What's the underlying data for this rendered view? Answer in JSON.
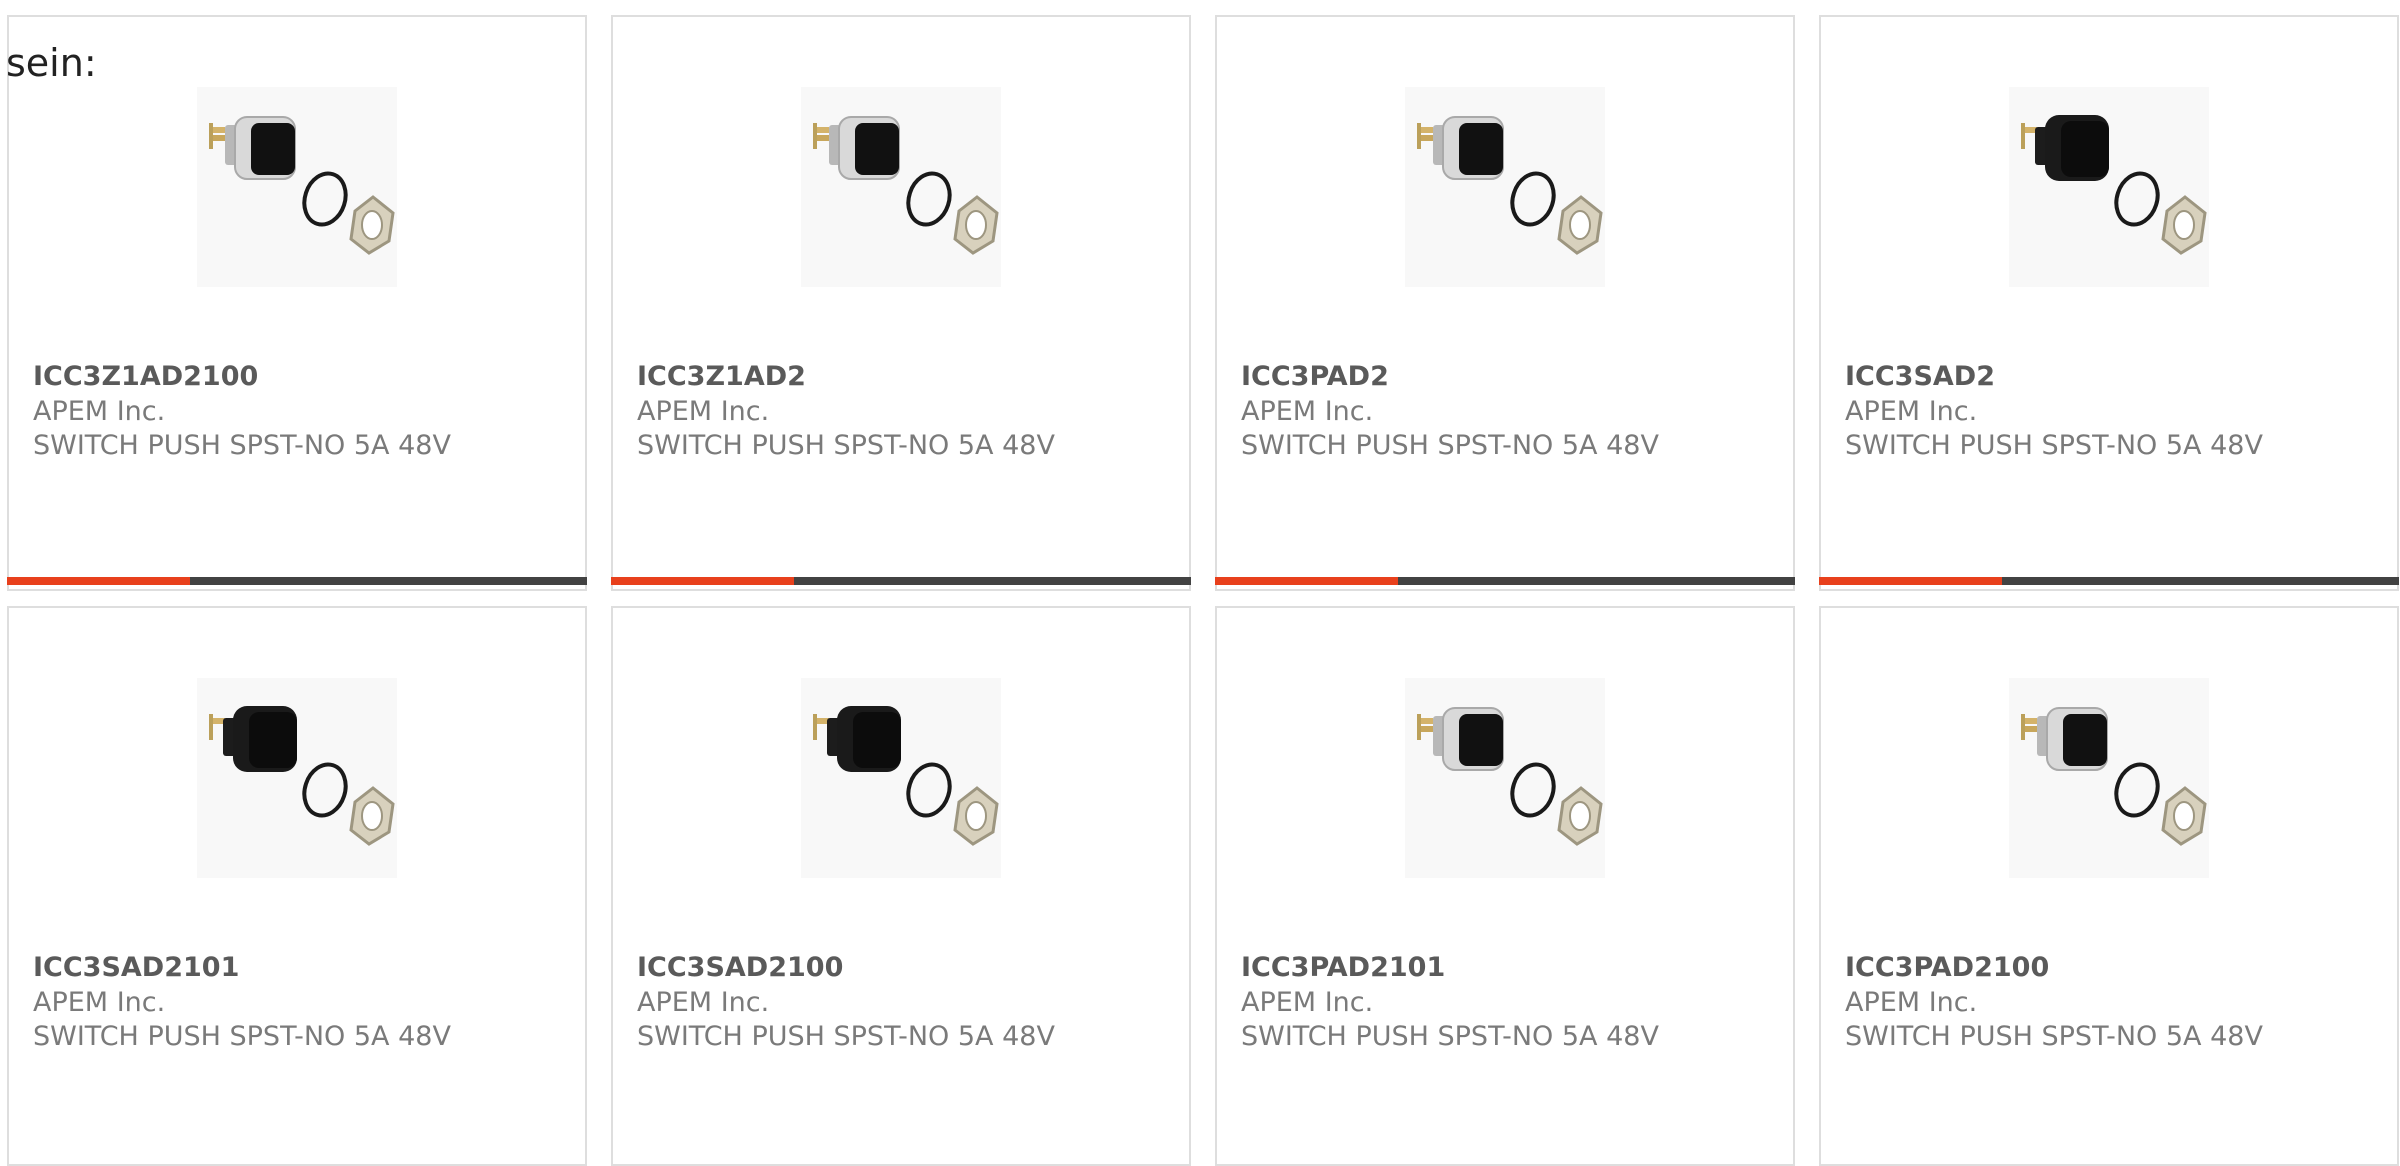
{
  "intro": "sein:",
  "colors": {
    "accent": "#e8401c",
    "bar": "#424242",
    "border": "#dedede"
  },
  "products": [
    {
      "part_number": "ICC3Z1AD2100",
      "manufacturer": "APEM Inc.",
      "description": "SWITCH PUSH SPST-NO 5A 48V",
      "image": "silver-bezel-switch"
    },
    {
      "part_number": "ICC3Z1AD2",
      "manufacturer": "APEM Inc.",
      "description": "SWITCH PUSH SPST-NO 5A 48V",
      "image": "silver-bezel-switch"
    },
    {
      "part_number": "ICC3PAD2",
      "manufacturer": "APEM Inc.",
      "description": "SWITCH PUSH SPST-NO 5A 48V",
      "image": "silver-bezel-switch"
    },
    {
      "part_number": "ICC3SAD2",
      "manufacturer": "APEM Inc.",
      "description": "SWITCH PUSH SPST-NO 5A 48V",
      "image": "black-bezel-switch"
    },
    {
      "part_number": "ICC3SAD2101",
      "manufacturer": "APEM Inc.",
      "description": "SWITCH PUSH SPST-NO 5A 48V",
      "image": "black-bezel-switch"
    },
    {
      "part_number": "ICC3SAD2100",
      "manufacturer": "APEM Inc.",
      "description": "SWITCH PUSH SPST-NO 5A 48V",
      "image": "black-bezel-switch"
    },
    {
      "part_number": "ICC3PAD2101",
      "manufacturer": "APEM Inc.",
      "description": "SWITCH PUSH SPST-NO 5A 48V",
      "image": "silver-bezel-switch"
    },
    {
      "part_number": "ICC3PAD2100",
      "manufacturer": "APEM Inc.",
      "description": "SWITCH PUSH SPST-NO 5A 48V",
      "image": "silver-bezel-switch"
    }
  ]
}
